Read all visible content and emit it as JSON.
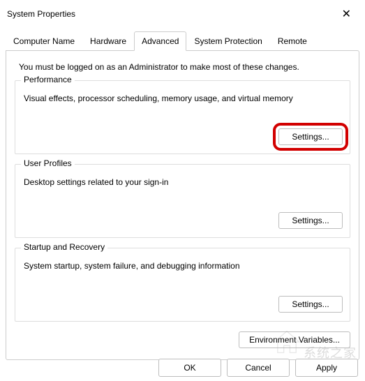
{
  "window": {
    "title": "System Properties",
    "close_label": "✕"
  },
  "tabs": [
    {
      "label": "Computer Name"
    },
    {
      "label": "Hardware"
    },
    {
      "label": "Advanced"
    },
    {
      "label": "System Protection"
    },
    {
      "label": "Remote"
    }
  ],
  "intro": "You must be logged on as an Administrator to make most of these changes.",
  "groups": {
    "performance": {
      "legend": "Performance",
      "desc": "Visual effects, processor scheduling, memory usage, and virtual memory",
      "button": "Settings..."
    },
    "user_profiles": {
      "legend": "User Profiles",
      "desc": "Desktop settings related to your sign-in",
      "button": "Settings..."
    },
    "startup": {
      "legend": "Startup and Recovery",
      "desc": "System startup, system failure, and debugging information",
      "button": "Settings..."
    }
  },
  "env_button": "Environment Variables...",
  "bottom": {
    "ok": "OK",
    "cancel": "Cancel",
    "apply": "Apply"
  },
  "watermark": "系统之家"
}
